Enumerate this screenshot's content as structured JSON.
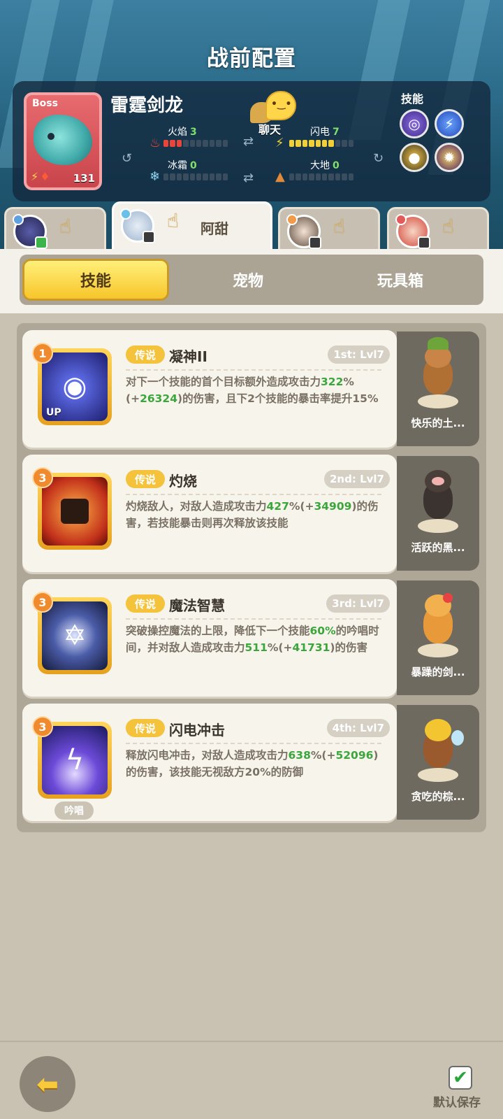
{
  "header": {
    "title": "战前配置",
    "boss": {
      "tag": "Boss",
      "name": "雷霆剑龙",
      "level": "131"
    },
    "attributes": {
      "fire": {
        "label": "火焰",
        "value": "3",
        "level": 3
      },
      "lightning": {
        "label": "闪电",
        "value": "7",
        "level": 7
      },
      "frost": {
        "label": "冰霜",
        "value": "0",
        "level": 0
      },
      "earth": {
        "label": "大地",
        "value": "0",
        "level": 0
      }
    },
    "chat_label": "聊天",
    "skills_label": "技能",
    "skill_icons": [
      "vortex-icon",
      "lightning-icon",
      "beast-icon",
      "dark-orb-icon"
    ]
  },
  "hero_tabs": [
    {
      "name": "",
      "active": false
    },
    {
      "name": "阿甜",
      "active": true
    },
    {
      "name": "",
      "active": false
    },
    {
      "name": "",
      "active": false
    }
  ],
  "category_tabs": [
    {
      "label": "技能",
      "active": true
    },
    {
      "label": "宠物",
      "active": false
    },
    {
      "label": "玩具箱",
      "active": false
    }
  ],
  "skills": [
    {
      "rank": "1",
      "rarity": "传说",
      "name": "凝神II",
      "slot": "1st: Lvl7",
      "desc_parts": [
        "对下一个技能的首个目标额外造成攻击力",
        "322",
        "%(+",
        "26324",
        ")的伤害，且下2个技能的暴击率提升15%"
      ],
      "icon_badge": "UP",
      "pet_name": "快乐的土..."
    },
    {
      "rank": "3",
      "rarity": "传说",
      "name": "灼烧",
      "slot": "2nd: Lvl7",
      "desc_parts": [
        "灼烧敌人，对敌人造成攻击力",
        "427",
        "%(+",
        "34909",
        ")的伤害，若技能暴击则再次释放该技能"
      ],
      "pet_name": "活跃的黑..."
    },
    {
      "rank": "3",
      "rarity": "传说",
      "name": "魔法智慧",
      "slot": "3rd: Lvl7",
      "desc_parts": [
        "突破操控魔法的上限，降低下一个技能",
        "60%",
        "的吟唱时间，并对敌人造成攻击力",
        "511",
        "%(+",
        "41731",
        ")的伤害"
      ],
      "pet_name": "暴躁的剑..."
    },
    {
      "rank": "3",
      "rarity": "传说",
      "name": "闪电冲击",
      "slot": "4th: Lvl7",
      "desc_parts": [
        "释放闪电冲击，对敌人造成攻击力",
        "638",
        "%(+",
        "52096",
        ")的伤害，该技能无视敌方20%的防御"
      ],
      "chant": "吟唱",
      "pet_name": "贪吃的棕..."
    }
  ],
  "footer": {
    "save_label": "默认保存"
  }
}
